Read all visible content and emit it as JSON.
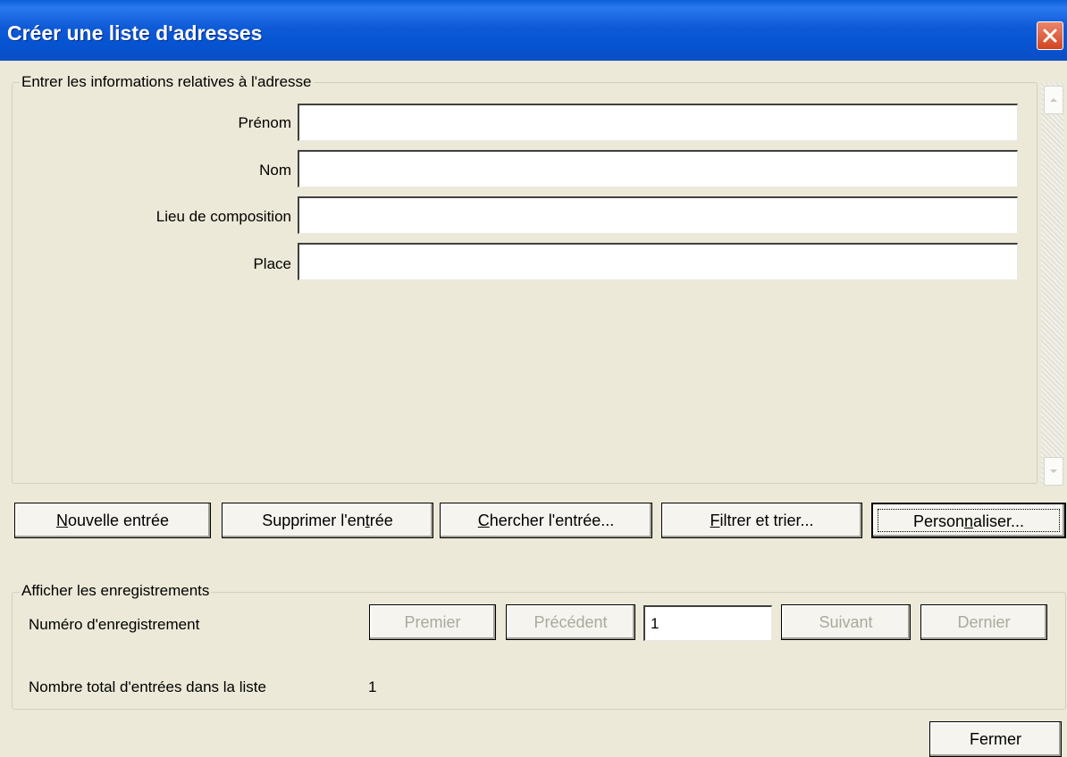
{
  "window": {
    "title": "Créer une liste d'adresses"
  },
  "address_group": {
    "legend": "Entrer les informations relatives à l'adresse",
    "fields": [
      {
        "label": "Prénom",
        "value": ""
      },
      {
        "label": "Nom",
        "value": ""
      },
      {
        "label": "Lieu de composition",
        "value": ""
      },
      {
        "label": "Place",
        "value": ""
      }
    ]
  },
  "actions": {
    "new_entry": {
      "pre": "",
      "key": "N",
      "post": "ouvelle entrée"
    },
    "delete_entry": {
      "pre": "Supprimer l'en",
      "key": "t",
      "post": "rée"
    },
    "find_entry": {
      "pre": "",
      "key": "C",
      "post": "hercher l'entrée..."
    },
    "filter_sort": {
      "pre": "",
      "key": "F",
      "post": "iltrer et trier..."
    },
    "customize": {
      "pre": "Person",
      "key": "n",
      "post": "aliser..."
    }
  },
  "records_group": {
    "legend": "Afficher les enregistrements",
    "record_label": {
      "pre": "Numéro d'enre",
      "key": "g",
      "post": "istrement"
    },
    "first": "Premier",
    "previous": "Précédent",
    "current": "1",
    "next": "Suivant",
    "last": "Dernier",
    "total_label": "Nombre total d'entrées dans la liste",
    "total_value": "1"
  },
  "close_label": "Fermer",
  "icons": {
    "close": "close-icon",
    "scroll_up": "arrow-up-icon",
    "scroll_down": "arrow-down-icon"
  }
}
